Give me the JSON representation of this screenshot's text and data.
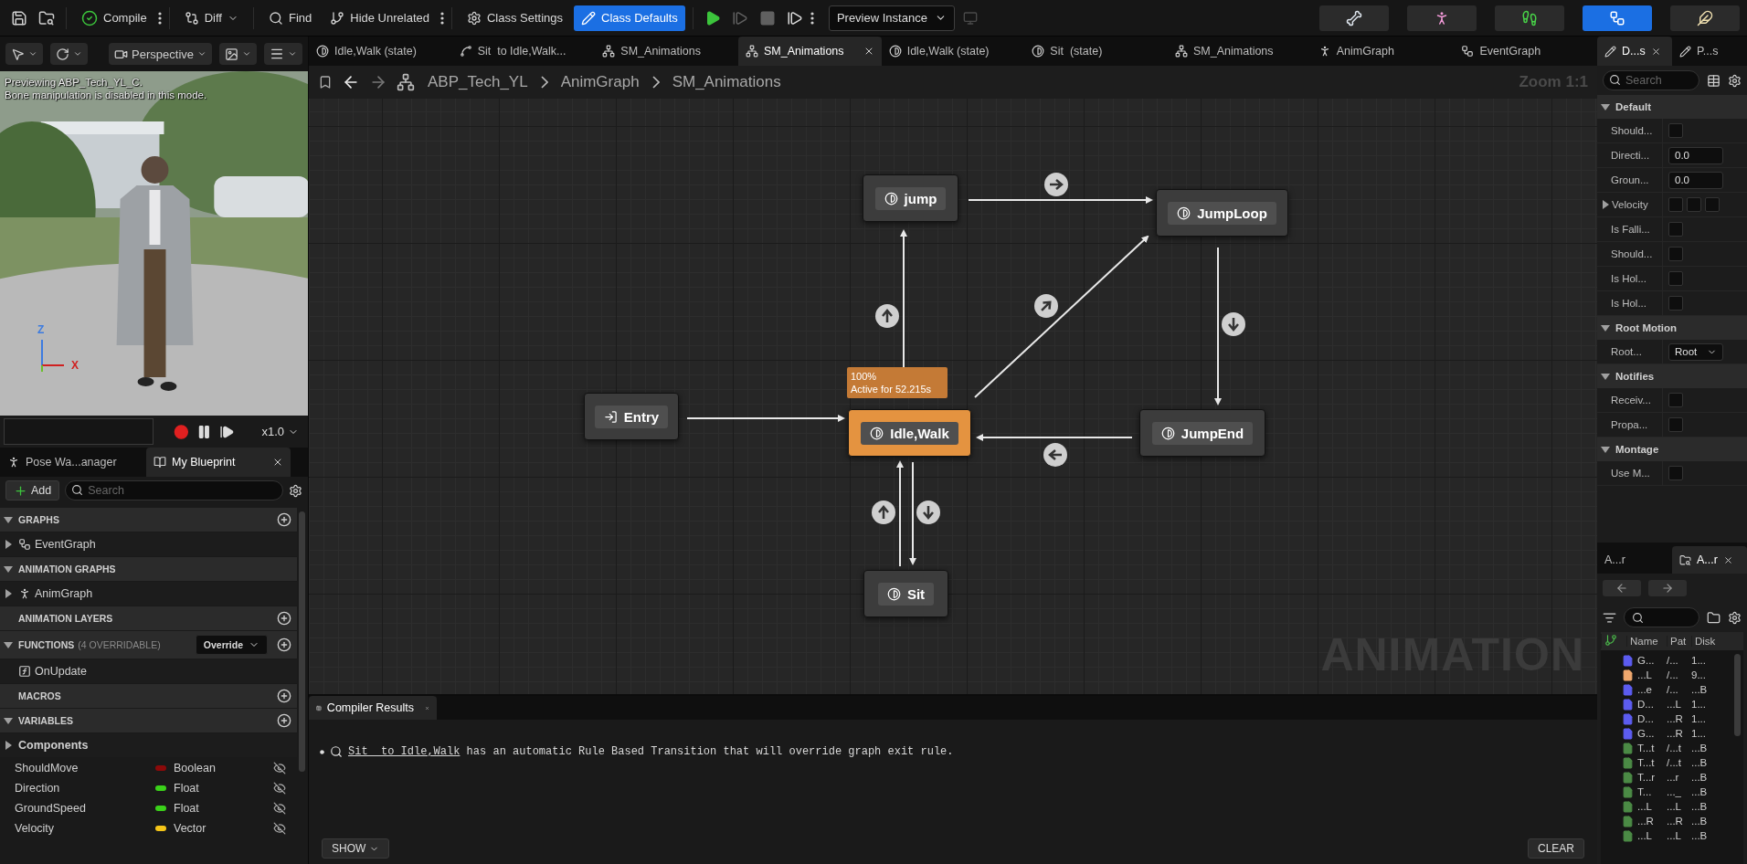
{
  "toolbar": {
    "compile": "Compile",
    "diff": "Diff",
    "find": "Find",
    "hide_unrelated": "Hide Unrelated",
    "class_settings": "Class Settings",
    "class_defaults": {
      "label": "Class Defaults",
      "selected": true
    },
    "play_controls": [
      {
        "kind": "play",
        "disabled": false
      },
      {
        "kind": "step",
        "disabled": true
      },
      {
        "kind": "stop",
        "disabled": true
      },
      {
        "kind": "advance",
        "disabled": false
      }
    ],
    "preview_instance": "Preview Instance",
    "modes": [
      {
        "kind": "skeleton",
        "selected": false
      },
      {
        "kind": "mesh",
        "selected": false
      },
      {
        "kind": "animation",
        "selected": false
      },
      {
        "kind": "blueprint",
        "selected": true
      },
      {
        "kind": "physics",
        "selected": false
      }
    ]
  },
  "viewport": {
    "view_mode": "Perspective",
    "overlay": [
      "Previewing ABP_Tech_YL_C.",
      "Bone manipulation is disabled in this mode."
    ],
    "axes": [
      "Z",
      "X"
    ],
    "speed": "x1.0"
  },
  "left_tabs": [
    {
      "label": "Pose Wa...anager",
      "selected": false
    },
    {
      "label": "My Blueprint",
      "selected": true
    }
  ],
  "my_blueprint": {
    "add": "Add",
    "search": {
      "placeholder": "Search"
    },
    "rows": [
      {
        "kind": "section",
        "label": "GRAPHS",
        "expandable": true,
        "expanded": true,
        "addable": true
      },
      {
        "kind": "event_graph",
        "label": "EventGraph",
        "expandable": true,
        "expanded": false
      },
      {
        "kind": "section",
        "label": "ANIMATION GRAPHS",
        "expandable": true,
        "expanded": true,
        "addable": false
      },
      {
        "kind": "anim_graph",
        "label": "AnimGraph",
        "expandable": true,
        "expanded": false
      },
      {
        "kind": "section",
        "label": "ANIMATION LAYERS",
        "addable": true
      },
      {
        "kind": "section",
        "label": "FUNCTIONS",
        "note": "(4 OVERRIDABLE)",
        "dropdown": "Override",
        "expandable": true,
        "expanded": true,
        "addable": true
      },
      {
        "kind": "function",
        "label": "OnUpdate"
      },
      {
        "kind": "section",
        "label": "MACROS",
        "addable": true
      },
      {
        "kind": "section",
        "label": "VARIABLES",
        "expandable": true,
        "expanded": true,
        "addable": true
      },
      {
        "kind": "category",
        "label": "Components",
        "expandable": true,
        "expanded": false
      },
      {
        "kind": "variable",
        "label": "ShouldMove",
        "type": "Boolean",
        "color": "#8c0a0a"
      },
      {
        "kind": "variable",
        "label": "Direction",
        "type": "Float",
        "color": "#3bd11a"
      },
      {
        "kind": "variable",
        "label": "GroundSpeed",
        "type": "Float",
        "color": "#3bd11a"
      },
      {
        "kind": "variable",
        "label": "Velocity",
        "type": "Vector",
        "color": "#f5c518"
      }
    ]
  },
  "graph_tabs": [
    {
      "label": "Idle,Walk (state)",
      "kind": "state",
      "selected": false
    },
    {
      "label": "Sit  to Idle,Walk...",
      "kind": "transition",
      "selected": false
    },
    {
      "label": "SM_Animations",
      "kind": "machine",
      "selected": false
    },
    {
      "label": "SM_Animations",
      "kind": "machine",
      "selected": true
    },
    {
      "label": "Idle,Walk (state)",
      "kind": "state",
      "selected": false
    },
    {
      "label": "Sit  (state)",
      "kind": "state",
      "selected": false
    },
    {
      "label": "SM_Animations",
      "kind": "machine",
      "selected": false
    },
    {
      "label": "AnimGraph",
      "kind": "anim",
      "selected": false
    },
    {
      "label": "EventGraph",
      "kind": "event",
      "selected": false
    }
  ],
  "breadcrumb": [
    "ABP_Tech_YL",
    "AnimGraph",
    "SM_Animations"
  ],
  "zoom": "Zoom 1:1",
  "states": [
    {
      "label": "jump",
      "kind": "state",
      "active": false
    },
    {
      "label": "JumpLoop",
      "kind": "state",
      "active": false
    },
    {
      "label": "Entry",
      "kind": "entry",
      "active": false
    },
    {
      "label": "Idle,Walk",
      "kind": "state",
      "active": true
    },
    {
      "label": "JumpEnd",
      "kind": "state",
      "active": false
    },
    {
      "label": "Sit",
      "kind": "state",
      "active": false
    }
  ],
  "active_tooltip": [
    "100%",
    "Active for 52.215s"
  ],
  "graph_type": "ANIMATION",
  "bottom_tabs": [
    {
      "label": "Compiler Results",
      "selected": true
    }
  ],
  "messages": [
    {
      "link": "Sit  to Idle,Walk",
      "text": " has an automatic Rule Based Transition that will override graph exit rule."
    }
  ],
  "show": "SHOW",
  "clear": "CLEAR",
  "details_tabs": [
    {
      "label": "D...s",
      "selected": true
    },
    {
      "label": "P...s",
      "selected": false
    }
  ],
  "details_search": {
    "placeholder": "Search"
  },
  "property_groups": [
    {
      "label": "Default",
      "expanded": true,
      "props": [
        {
          "kind": "checkbox",
          "label": "Should...",
          "checked": false
        },
        {
          "kind": "number",
          "label": "Directi...",
          "value": "0.0"
        },
        {
          "kind": "number",
          "label": "Groun...",
          "value": "0.0"
        },
        {
          "kind": "vector",
          "label": "Velocity",
          "expanded": false
        },
        {
          "kind": "checkbox",
          "label": "Is Falli...",
          "checked": false
        },
        {
          "kind": "checkbox",
          "label": "Should...",
          "checked": false
        },
        {
          "kind": "checkbox",
          "label": "Is Hol...",
          "checked": false
        },
        {
          "kind": "checkbox",
          "label": "Is Hol...",
          "checked": false
        }
      ]
    },
    {
      "label": "Root Motion",
      "expanded": true,
      "props": [
        {
          "kind": "dropdown",
          "label": "Root...",
          "value": "Root"
        }
      ]
    },
    {
      "label": "Notifies",
      "expanded": true,
      "props": [
        {
          "kind": "checkbox",
          "label": "Receiv...",
          "checked": false
        },
        {
          "kind": "checkbox",
          "label": "Propa...",
          "checked": false
        }
      ]
    },
    {
      "label": "Montage",
      "expanded": true,
      "props": [
        {
          "kind": "checkbox",
          "label": "Use M...",
          "checked": false
        }
      ]
    }
  ],
  "browser_tabs": [
    {
      "label": "A...r",
      "selected": false
    },
    {
      "label": "A...r",
      "selected": true
    }
  ],
  "browser_columns": [
    "Name",
    "Pat",
    "Disk"
  ],
  "assets": [
    {
      "name": "G...",
      "path": "/...",
      "disk": "1...",
      "color": "#5c5cf0"
    },
    {
      "name": "...L",
      "path": "/...",
      "disk": "9...",
      "color": "#f0a86e"
    },
    {
      "name": "...e",
      "path": "/...",
      "disk": "...B",
      "color": "#5c5cf0"
    },
    {
      "name": "D...",
      "path": "...L",
      "disk": "1...",
      "color": "#5c5cf0"
    },
    {
      "name": "D...",
      "path": "...R",
      "disk": "1...",
      "color": "#5c5cf0"
    },
    {
      "name": "G...",
      "path": "...R",
      "disk": "1...",
      "color": "#5c5cf0"
    },
    {
      "name": "T...t",
      "path": "/...t",
      "disk": "...B",
      "color": "#4b8a45"
    },
    {
      "name": "T...t",
      "path": "/...t",
      "disk": "...B",
      "color": "#4b8a45"
    },
    {
      "name": "T...r",
      "path": "...r",
      "disk": "...B",
      "color": "#4b8a45"
    },
    {
      "name": "T...",
      "path": "..._",
      "disk": "...B",
      "color": "#4b8a45"
    },
    {
      "name": "...L",
      "path": "...L",
      "disk": "...B",
      "color": "#4b8a45"
    },
    {
      "name": "...R",
      "path": "...R",
      "disk": "...B",
      "color": "#4b8a45"
    },
    {
      "name": "...L",
      "path": "...L",
      "disk": "...B",
      "color": "#4b8a45"
    }
  ]
}
